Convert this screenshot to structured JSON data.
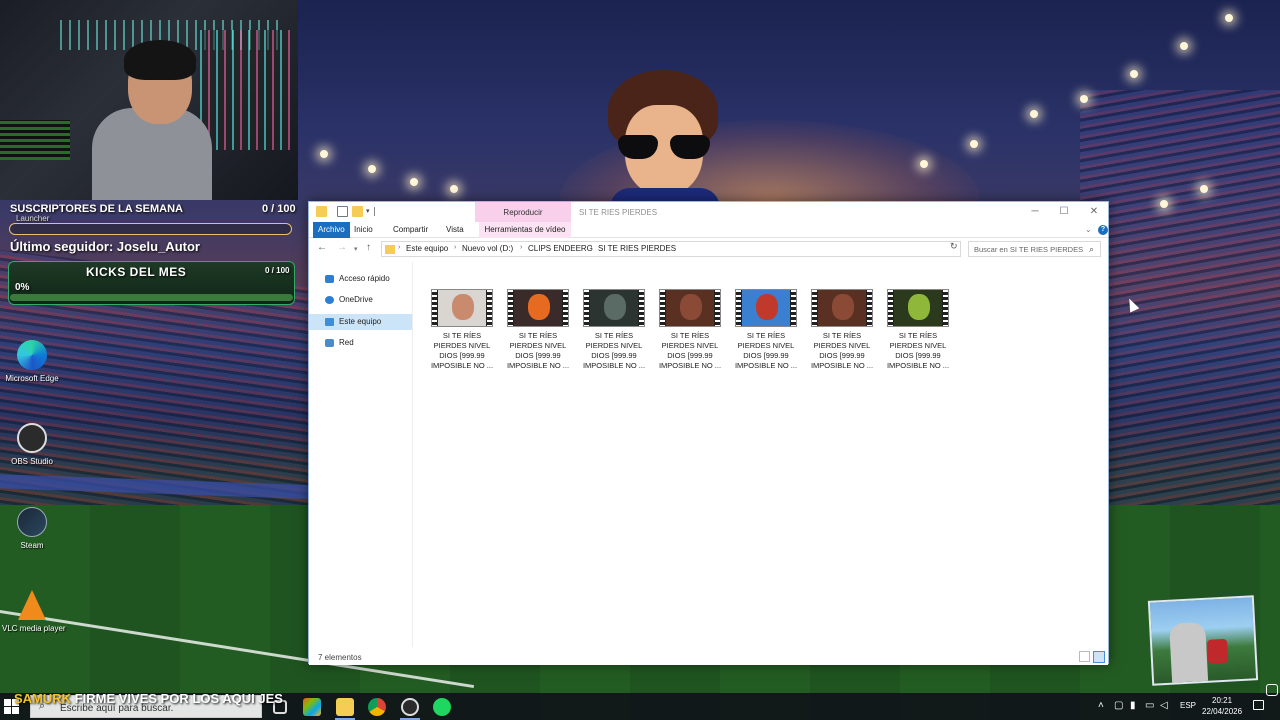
{
  "overlay": {
    "subs_title": "SUSCRIPTORES DE LA SEMANA",
    "subs_count": "0 / 100",
    "launcher_text": "Launcher",
    "follower": "Último seguidor: Joselu_Autor",
    "kicks_title": "KICKS DEL MES",
    "kicks_count": "0 / 100",
    "kicks_percent": "0%",
    "kicks_progress": 0,
    "banner_name": "SAMURK",
    "banner_message": "FIRME VIVES POR LOS AQUI JES"
  },
  "desktop_icons": [
    {
      "label": "Microsoft Edge",
      "icon": "edge-icon"
    },
    {
      "label": "OBS Studio",
      "icon": "obs-icon"
    },
    {
      "label": "Steam",
      "icon": "steam-icon"
    },
    {
      "label": "VLC media player",
      "icon": "vlc-icon"
    }
  ],
  "explorer": {
    "title": "SI TE RIES PIERDES",
    "context_tab": "Reproducir",
    "ribbon_tabs": {
      "archivo": "Archivo",
      "inicio": "Inicio",
      "compartir": "Compartir",
      "vista": "Vista",
      "video_tools": "Herramientas de vídeo"
    },
    "breadcrumb": [
      "Este equipo",
      "Nuevo vol (D:)",
      "CLIPS ENDEERG",
      "SI TE RIES PIERDES"
    ],
    "search_placeholder": "Buscar en SI TE RIES PIERDES",
    "nav_items": {
      "quick_access": "Acceso rápido",
      "onedrive": "OneDrive",
      "this_pc": "Este equipo",
      "network": "Red"
    },
    "files": [
      {
        "name": "SI TE RÍES PIERDES NIVEL DIOS [999.99 IMPOSIBLE NO ...",
        "bg": "#d9d6d2",
        "subject": "#c98a6e"
      },
      {
        "name": "SI TE RÍES PIERDES NIVEL DIOS [999.99 IMPOSIBLE NO ...",
        "bg": "#3b2a2a",
        "subject": "#e66a1f"
      },
      {
        "name": "SI TE RÍES PIERDES NIVEL DIOS [999.99 IMPOSIBLE NO ...",
        "bg": "#2c3432",
        "subject": "#5a6a64"
      },
      {
        "name": "SI TE RÍES PIERDES NIVEL DIOS [999.99 IMPOSIBLE NO ...",
        "bg": "#5a3022",
        "subject": "#8a4a36"
      },
      {
        "name": "SI TE RÍES PIERDES NIVEL DIOS [999.99 IMPOSIBLE NO ...",
        "bg": "#3b7fd0",
        "subject": "#c0392b"
      },
      {
        "name": "SI TE RÍES PIERDES NIVEL DIOS [999.99 IMPOSIBLE NO ...",
        "bg": "#5a3022",
        "subject": "#8a4a36"
      },
      {
        "name": "SI TE RÍES PIERDES NIVEL DIOS [999.99 IMPOSIBLE NO ...",
        "bg": "#2b3a1c",
        "subject": "#8fb83a"
      }
    ],
    "status": "7 elementos"
  },
  "taskbar": {
    "search_placeholder": "Escribe aquí para buscar.",
    "language": "ESP",
    "time": "20:21",
    "date": "22/04/2026"
  },
  "colors": {
    "accent": "#1a6ec0",
    "context_tab": "#f9d0ec",
    "overlay_gold": "#f4c12a",
    "kicks_green": "#3b7a3d"
  }
}
